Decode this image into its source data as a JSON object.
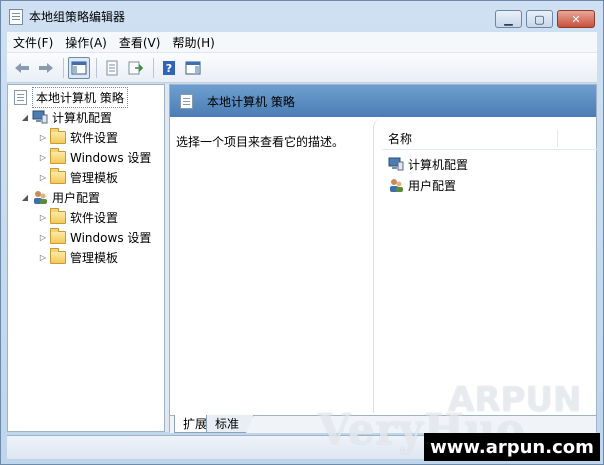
{
  "window": {
    "title": "本地组策略编辑器"
  },
  "menu": [
    "文件(F)",
    "操作(A)",
    "查看(V)",
    "帮助(H)"
  ],
  "tree": {
    "root": "本地计算机 策略",
    "computer": {
      "label": "计算机配置",
      "children": [
        "软件设置",
        "Windows 设置",
        "管理模板"
      ]
    },
    "user": {
      "label": "用户配置",
      "children": [
        "软件设置",
        "Windows 设置",
        "管理模板"
      ]
    }
  },
  "content": {
    "header": "本地计算机 策略",
    "description": "选择一个项目来查看它的描述。",
    "column_name": "名称",
    "items": [
      "计算机配置",
      "用户配置"
    ]
  },
  "tabs": [
    "扩展",
    "标准"
  ],
  "watermark": {
    "verybig": "VeryHuo",
    "arpun": "ARPUN",
    "url": "www.arpun.com"
  },
  "colors": {
    "header_blue": "#5a8cc3",
    "folder": "#f5c95b"
  }
}
